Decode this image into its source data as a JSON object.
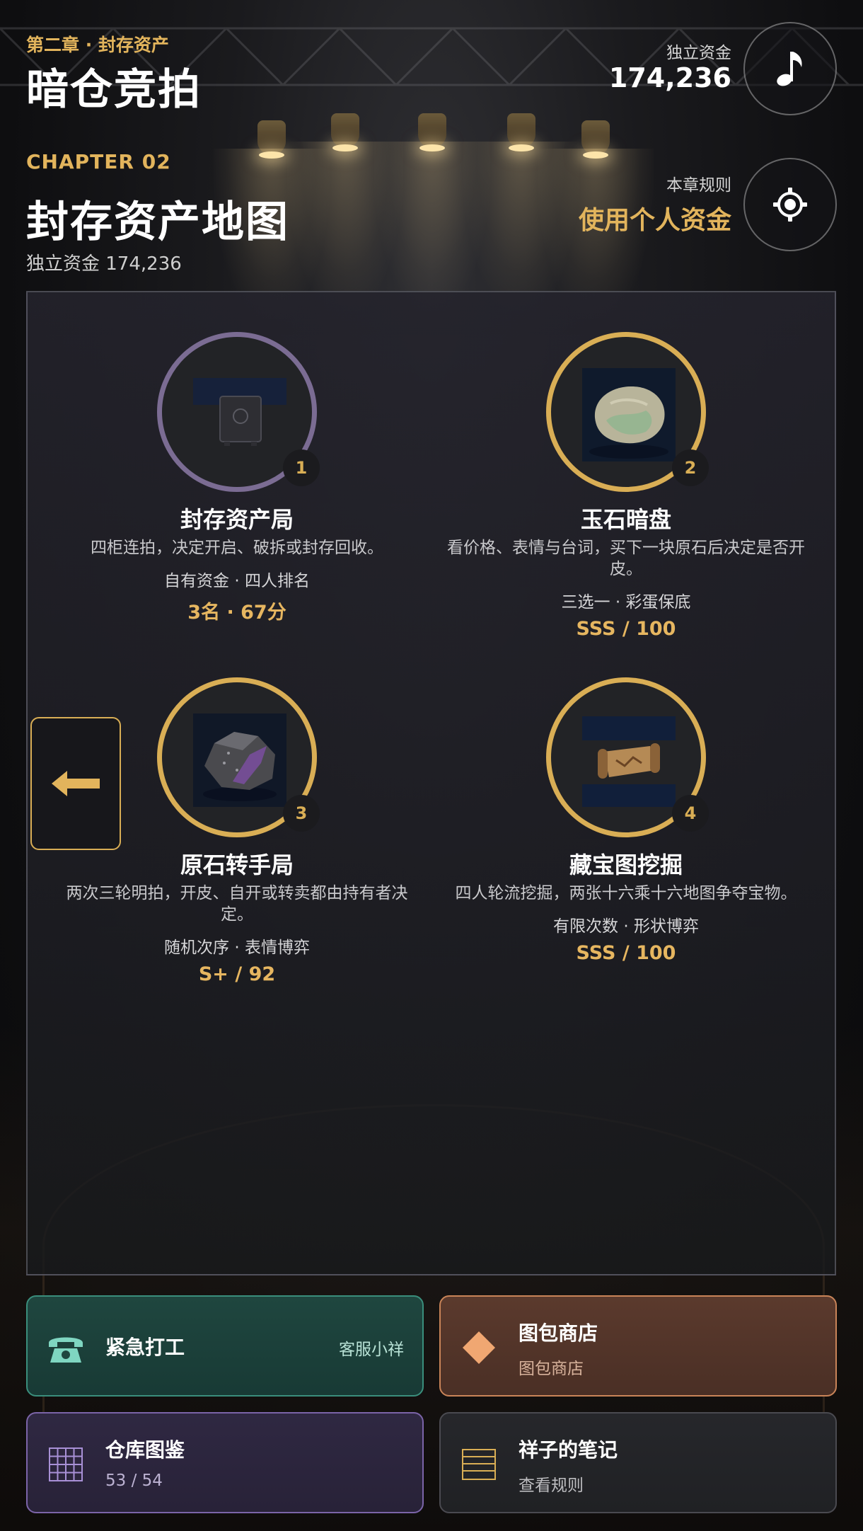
{
  "header": {
    "chapter_sub": "第二章 · 封存资产",
    "app_title": "暗仓竞拍",
    "fund_label": "独立资金",
    "fund_value": "174,236",
    "chapter_en": "CHAPTER 02",
    "map_title": "封存资产地图",
    "sub_fund": "独立资金 174,236",
    "rule_label": "本章规则",
    "rule_value": "使用个人资金"
  },
  "icons": {
    "music": "music-note-icon",
    "settings": "settings-gear-icon",
    "back": "arrow-left-icon"
  },
  "nodes": [
    {
      "name": "封存资产局",
      "desc": "四柜连拍，决定开启、破拆或封存回收。",
      "meta": "自有资金 · 四人排名",
      "score": "3名 · 67分",
      "num": "1",
      "image": "safe-icon"
    },
    {
      "name": "玉石暗盘",
      "desc": "看价格、表情与台词，买下一块原石后决定是否开皮。",
      "meta": "三选一 · 彩蛋保底",
      "score": "SSS / 100",
      "num": "2",
      "image": "jade-stone-icon"
    },
    {
      "name": "原石转手局",
      "desc": "两次三轮明拍，开皮、自开或转卖都由持有者决定。",
      "meta": "随机次序 · 表情博弈",
      "score": "S+ / 92",
      "num": "3",
      "image": "raw-ore-icon"
    },
    {
      "name": "藏宝图挖掘",
      "desc": "四人轮流挖掘，两张十六乘十六地图争夺宝物。",
      "meta": "有限次数 · 形状博弈",
      "score": "SSS / 100",
      "num": "4",
      "image": "treasure-map-icon"
    }
  ],
  "cards": {
    "work": {
      "title": "紧急打工",
      "right": "客服小祥",
      "icon": "telephone-icon"
    },
    "shop": {
      "title": "图包商店",
      "sub": "图包商店",
      "icon": "diamond-icon"
    },
    "dex": {
      "title": "仓库图鉴",
      "sub": "53 / 54",
      "icon": "grid-icon"
    },
    "notes": {
      "title": "祥子的笔记",
      "sub": "查看规则",
      "icon": "notebook-icon"
    }
  },
  "colors": {
    "accent_gold": "#e2b45c",
    "locked_purple": "#7b6c93",
    "work_green": "#3a8e7c",
    "shop_orange": "#c98458",
    "dex_purple": "#7b64a8"
  }
}
